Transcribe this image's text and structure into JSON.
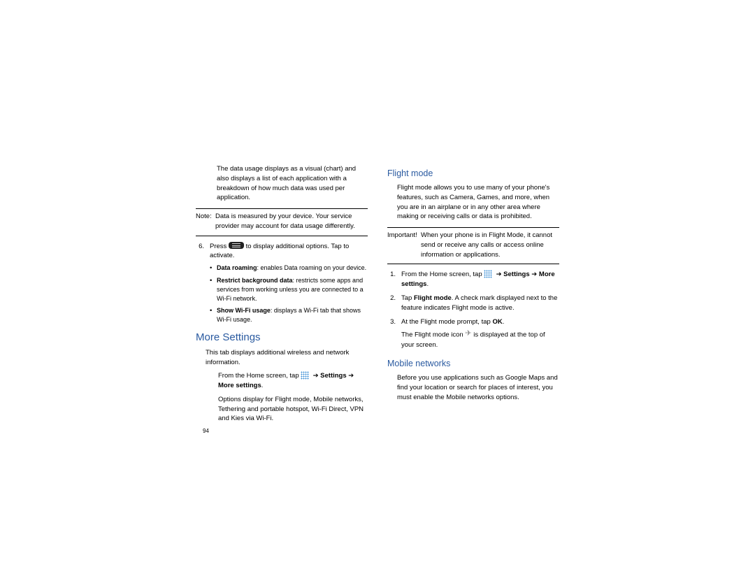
{
  "page_number": "94",
  "nav": {
    "settings": "Settings",
    "more_settings": "More settings",
    "arrow": "➔"
  },
  "left": {
    "data_usage_intro1": "The data usage displays as a visual (chart) and also displays a list of each application with a breakdown of how much data was used per application.",
    "note_label": "Note:",
    "note_text": "Data is measured by your device. Your service provider may account for data usage differently.",
    "step6_num": "6.",
    "step6a": "Press",
    "step6b": "to display additional options. Tap to activate.",
    "bullet1_bold": "Data roaming",
    "bullet1_rest": ": enables Data roaming on your device.",
    "bullet2_bold": "Restrict background data",
    "bullet2_rest": ": restricts some apps and services from working unless you are connected to a Wi-Fi network.",
    "bullet3_bold": "Show Wi-Fi usage",
    "bullet3_rest": ": displays a Wi-Fi tab that shows Wi-Fi usage.",
    "h_more": "More Settings",
    "more_intro": "This tab displays additional wireless and network information.",
    "from_home": "From the Home screen, tap",
    "more_settings_end": ".",
    "options_text": "Options display for Flight mode, Mobile networks, Tethering and portable hotspot, Wi-Fi Direct, VPN and Kies via Wi-Fi."
  },
  "right": {
    "h_flight": "Flight mode",
    "flight_intro": "Flight mode allows you to use many of your phone's features, such as Camera, Games, and more, when you are in an airplane or in any other area where making or receiving calls or data is prohibited.",
    "imp_label": "Important!",
    "imp_text": "When your phone is in Flight Mode, it cannot send or receive any calls or access online information or applications.",
    "s1_num": "1.",
    "s1_a": "From the Home screen, tap",
    "s1_end": ".",
    "s2_num": "2.",
    "s2_text_a": "Tap ",
    "s2_bold": "Flight mode",
    "s2_text_b": ". A check mark displayed next to the feature indicates Flight mode is active.",
    "s3_num": "3.",
    "s3_text_a": "At the Flight mode prompt, tap ",
    "s3_bold": "OK",
    "s3_text_b": ".",
    "s3_line2a": "The Flight mode icon",
    "s3_line2b": "is displayed at the top of your screen.",
    "h_mobile": "Mobile networks",
    "mobile_intro": "Before you use applications such as Google Maps and find your location or search for places of interest, you must enable the Mobile networks options."
  }
}
